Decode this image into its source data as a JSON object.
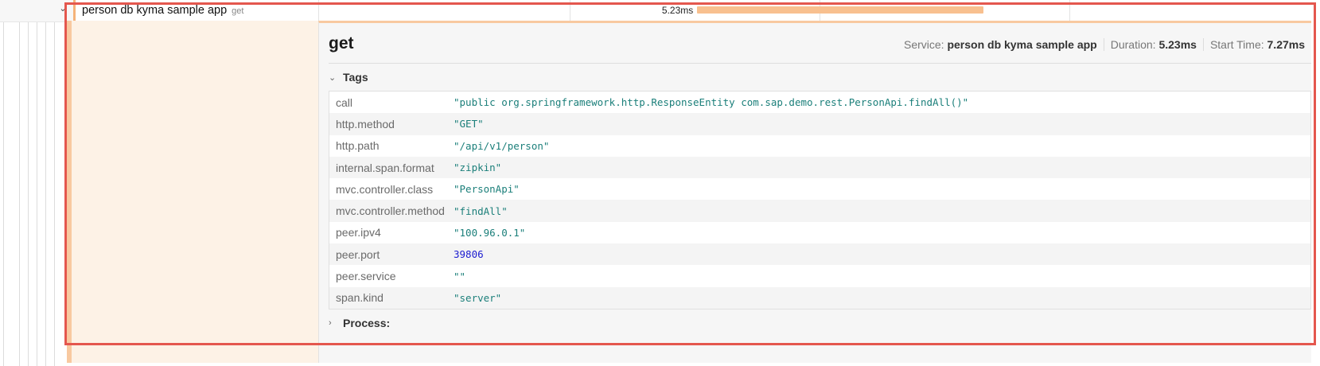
{
  "span_row": {
    "service_name": "person db kyma sample app",
    "operation": "get",
    "duration_label": "5.23ms",
    "bar": {
      "start_fraction": 0.378,
      "width_fraction": 0.286
    }
  },
  "detail": {
    "title": "get",
    "meta": {
      "service_label": "Service:",
      "service_value": "person db kyma sample app",
      "duration_label": "Duration:",
      "duration_value": "5.23ms",
      "start_label": "Start Time:",
      "start_value": "7.27ms"
    },
    "tags_section": {
      "label": "Tags",
      "expanded": true,
      "rows": [
        {
          "key": "call",
          "value": "\"public org.springframework.http.ResponseEntity com.sap.demo.rest.PersonApi.findAll()\"",
          "type": "string"
        },
        {
          "key": "http.method",
          "value": "\"GET\"",
          "type": "string"
        },
        {
          "key": "http.path",
          "value": "\"/api/v1/person\"",
          "type": "string"
        },
        {
          "key": "internal.span.format",
          "value": "\"zipkin\"",
          "type": "string"
        },
        {
          "key": "mvc.controller.class",
          "value": "\"PersonApi\"",
          "type": "string"
        },
        {
          "key": "mvc.controller.method",
          "value": "\"findAll\"",
          "type": "string"
        },
        {
          "key": "peer.ipv4",
          "value": "\"100.96.0.1\"",
          "type": "string"
        },
        {
          "key": "peer.port",
          "value": "39806",
          "type": "number"
        },
        {
          "key": "peer.service",
          "value": "\"\"",
          "type": "string"
        },
        {
          "key": "span.kind",
          "value": "\"server\"",
          "type": "string"
        }
      ]
    },
    "process_section": {
      "label": "Process:",
      "expanded": false
    }
  },
  "colors": {
    "highlight_frame": "#e4574e",
    "span_bar": "#f8c08f",
    "tag_string": "#1b7f7a",
    "tag_number": "#1c1cd0"
  },
  "icons": {
    "row_toggle": "chevron-down-icon",
    "tags_toggle": "chevron-down-icon",
    "process_toggle": "chevron-right-icon"
  }
}
